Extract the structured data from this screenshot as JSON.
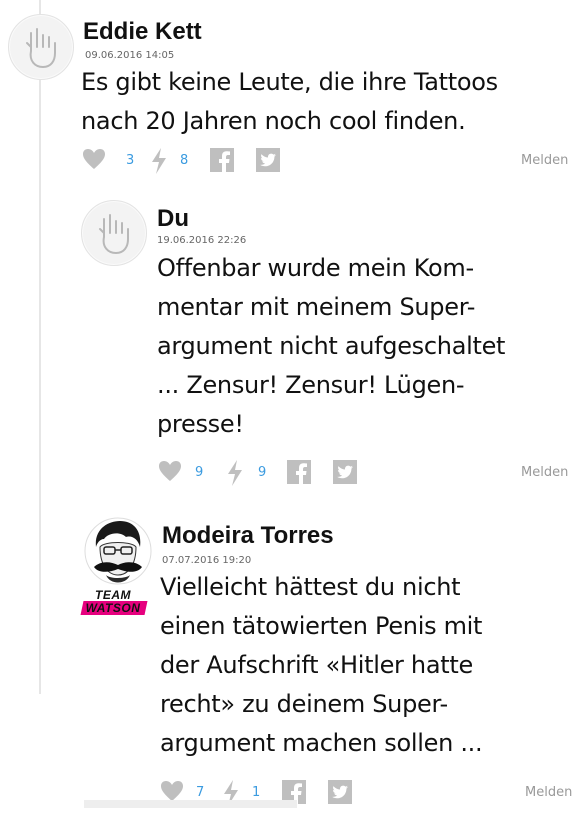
{
  "comments": [
    {
      "author": "Eddie Kett",
      "date": "09.06.2016 14:05",
      "lines": [
        "Es gibt keine Leute, die ihre Tattoos",
        "nach 20 Jahren noch cool finden."
      ],
      "likes": "3",
      "bolts": "8",
      "report": "Melden"
    },
    {
      "author": "Du",
      "date": "19.06.2016 22:26",
      "lines": [
        "Offenbar wurde mein Kom-",
        "mentar mit meinem Super-",
        "argument nicht aufgeschaltet",
        "... Zensur! Zensur! Lügen-",
        "presse!"
      ],
      "likes": "9",
      "bolts": "9",
      "report": "Melden"
    },
    {
      "author": "Modeira Torres",
      "date": "07.07.2016 19:20",
      "badge": "TEAM WATSON",
      "lines": [
        "Vielleicht hättest du nicht",
        "einen tätowierten Penis mit",
        "der Aufschrift «Hitler hatte",
        "recht» zu deinem Super-",
        "argument machen sollen ..."
      ],
      "likes": "7",
      "bolts": "1",
      "report": "Melden"
    }
  ],
  "icons": {
    "avatar_default": "rock-hand-icon",
    "like": "heart-icon",
    "bolt": "lightning-icon",
    "facebook": "facebook-icon",
    "twitter": "twitter-icon"
  },
  "colors": {
    "count": "#3b9be0",
    "icon_gray": "#bfbfbf",
    "badge": "#e6007e"
  }
}
